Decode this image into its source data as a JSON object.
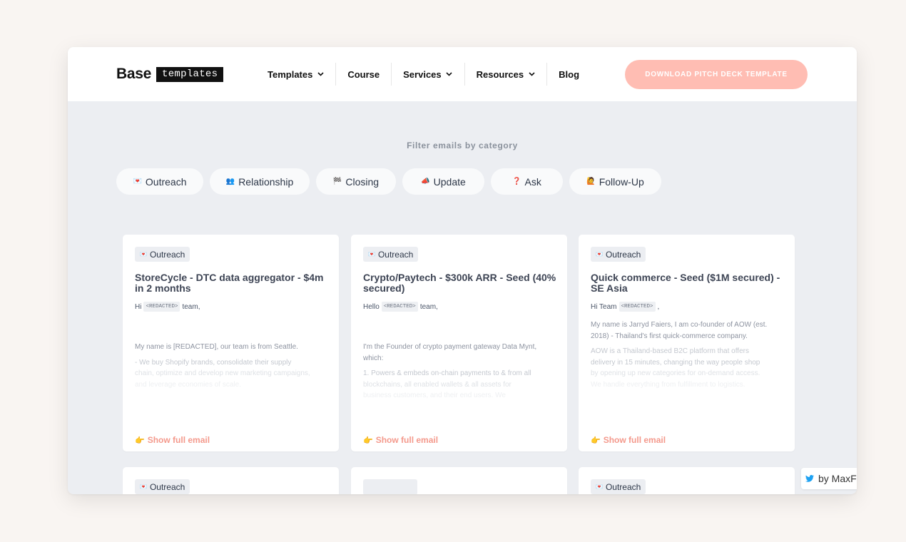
{
  "header": {
    "logo_base": "Base",
    "logo_templates": "templates",
    "nav": [
      {
        "label": "Templates",
        "dropdown": true
      },
      {
        "label": "Course",
        "dropdown": false
      },
      {
        "label": "Services",
        "dropdown": true
      },
      {
        "label": "Resources",
        "dropdown": true
      },
      {
        "label": "Blog",
        "dropdown": false
      }
    ],
    "cta_label": "DOWNLOAD PITCH DECK TEMPLATE"
  },
  "filter": {
    "title": "Filter emails by category",
    "chips": [
      {
        "emoji": "💌",
        "label": "Outreach"
      },
      {
        "emoji": "👥",
        "label": "Relationship"
      },
      {
        "emoji": "🏁",
        "label": "Closing"
      },
      {
        "emoji": "📣",
        "label": "Update"
      },
      {
        "emoji": "❓",
        "label": "Ask"
      },
      {
        "emoji": "🙋",
        "label": "Follow-Up"
      }
    ]
  },
  "cards": [
    {
      "tag": "Outreach",
      "title": "StoreCycle - DTC data aggregator - $4m in 2 months",
      "greeting_prefix": "Hi",
      "greeting_redacted": "<REDACTED>",
      "greeting_suffix": "team,",
      "p1": "My name is [REDACTED], our team is from Seattle.",
      "p2a": "- We buy Shopify brands, consolidate their supply",
      "p2b": "chain, optimize and develop new marketing campaigns,",
      "p2c": "and leverage economies of scale.",
      "show_full": "Show full email"
    },
    {
      "tag": "Outreach",
      "title": "Crypto/Paytech - $300k ARR - Seed (40% secured)",
      "greeting_prefix": "Hello",
      "greeting_redacted": "<REDACTED>",
      "greeting_suffix": "team,",
      "p1a": "I'm the Founder of crypto payment gateway Data Mynt,",
      "p1b": "which:",
      "p2a": "1. Powers & embeds on-chain payments to & from all",
      "p2b": "blockchains, all enabled wallets & all assets for",
      "p2c": "business customers, and their end users. We",
      "show_full": "Show full email"
    },
    {
      "tag": "Outreach",
      "title": "Quick commerce - Seed ($1M secured) - SE Asia",
      "greeting_prefix": "Hi Team",
      "greeting_redacted": "<REDACTED>",
      "greeting_suffix": ",",
      "p1a": "My name is Jarryd Faiers, I am co-founder of AOW (est.",
      "p1b": "2018) - Thailand's first quick-commerce company.",
      "p2a": "AOW is a Thailand-based B2C platform that offers",
      "p2b": "delivery in 15 minutes, changing the way people shop",
      "p2c": "by opening up new categories for on-demand access.",
      "p2d": "We handle everything from fulfillment to logistics.",
      "show_full": "Show full email"
    }
  ],
  "row2": [
    {
      "tag": "Outreach"
    },
    {
      "tag": ""
    },
    {
      "tag": "Outreach"
    }
  ],
  "twitter_badge": "by MaxF"
}
